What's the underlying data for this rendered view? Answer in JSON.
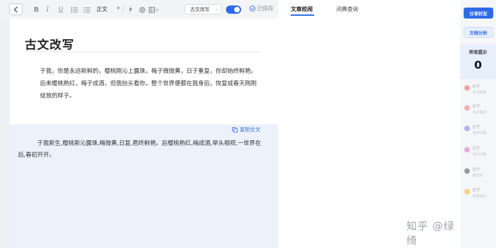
{
  "toolbar": {
    "paragraph_style": "正文",
    "mode": "古文改写",
    "saved": "已保存"
  },
  "document": {
    "title": "古文改写",
    "body": "于我，你是永远新鲜的，樱桃刚沁上露珠，梅子微微黄，日子重复，你却始终鲜艳。后来樱桃熟红，梅子成酒，但我抬头看你，整个世界便都在我身后，恢复成春天刚刚绽放的样子。"
  },
  "result": {
    "copy_label": "复制全文",
    "text": "于我新生,樱桃新沁露珠,梅微黄,日复,君终鲜艳。后樱桃熟红,梅成酒,举头相视,一世界在后,春初开开。"
  },
  "tabs": [
    {
      "label": "文章校阅",
      "active": true
    },
    {
      "label": "词典查询",
      "active": false
    }
  ],
  "watermark": "知乎 @绿绮",
  "sidebar": {
    "share_label": "分享好友",
    "analysis_label": "文档分析",
    "all_hints_label": "所有提示",
    "all_hints_count": "0",
    "categories": [
      {
        "count": "0个",
        "name": "字词错误",
        "color": "#f0a3a3"
      },
      {
        "count": "0个",
        "name": "标点错误",
        "color": "#f3b0b0"
      },
      {
        "count": "0个",
        "name": "语序问题",
        "color": "#b6b0ef"
      },
      {
        "count": "0个",
        "name": "语法问题",
        "color": "#e7a9d8"
      },
      {
        "count": "0个",
        "name": "敏感词",
        "color": "#9a9a9a"
      },
      {
        "count": "0个",
        "name": "其他提示",
        "color": "#f4d08a"
      }
    ]
  }
}
